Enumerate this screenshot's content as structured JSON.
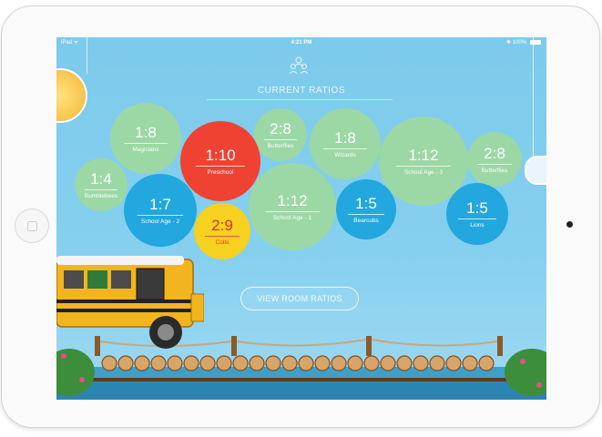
{
  "status_bar": {
    "left": "iPad ᯤ",
    "time": "4:21 PM",
    "right": "✱ 100%"
  },
  "header": {
    "icon": "children-group-icon",
    "title": "CURRENT RATIOS"
  },
  "rooms": [
    {
      "ratio": "1:8",
      "name": "Magicians",
      "color": "#9bd8a5"
    },
    {
      "ratio": "2:8",
      "name": "Butterflies",
      "color": "#9bd8a5"
    },
    {
      "ratio": "1:8",
      "name": "Wizards",
      "color": "#9bd8a5"
    },
    {
      "ratio": "1:12",
      "name": "School Age - 3",
      "color": "#9bd8a5"
    },
    {
      "ratio": "2:8",
      "name": "Butterflies",
      "color": "#9bd8a5"
    },
    {
      "ratio": "1:10",
      "name": "Preschool",
      "color": "#ef4232"
    },
    {
      "ratio": "1:4",
      "name": "Bumblebees",
      "color": "#9bd8a5"
    },
    {
      "ratio": "1:7",
      "name": "School Age - 2",
      "color": "#22a7df"
    },
    {
      "ratio": "1:12",
      "name": "School Age - 1",
      "color": "#9bd8a5"
    },
    {
      "ratio": "1:5",
      "name": "Bearcubs",
      "color": "#22a7df"
    },
    {
      "ratio": "1:5",
      "name": "Lions",
      "color": "#22a7df"
    },
    {
      "ratio": "2:9",
      "name": "Colts",
      "color": "#f7d11f"
    }
  ],
  "view_button": {
    "label": "VIEW ROOM RATIOS"
  },
  "decor": {
    "sun": "sun-icon",
    "moon": "moon-icon",
    "bus": "school-bus-illustration",
    "bridge": "wooden-bridge-illustration"
  }
}
